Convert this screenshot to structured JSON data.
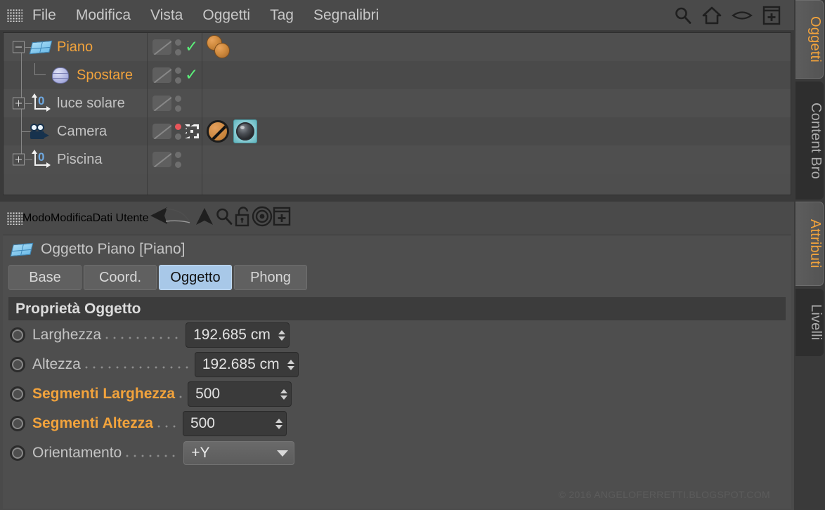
{
  "object_manager": {
    "menu": [
      "File",
      "Modifica",
      "Vista",
      "Oggetti",
      "Tag",
      "Segnalibri"
    ],
    "toolbar_icons": [
      "search-icon",
      "home-icon",
      "eye-icon",
      "add-box-icon"
    ],
    "tree": [
      {
        "name": "Piano",
        "selected": true,
        "icon": "plane-object-icon",
        "expander": "minus",
        "depth": 0,
        "visibility": "check",
        "tags": [
          "material-sphere",
          "material-sphere"
        ]
      },
      {
        "name": "Spostare",
        "selected": true,
        "icon": "deformer-object-icon",
        "expander": "none",
        "depth": 1,
        "visibility": "check",
        "tags": []
      },
      {
        "name": "luce solare",
        "selected": false,
        "icon": "null-axis-icon",
        "expander": "plus",
        "depth": 0,
        "visibility": "none",
        "tags": []
      },
      {
        "name": "Camera",
        "selected": false,
        "icon": "camera-object-icon",
        "expander": "none",
        "depth": 0,
        "visibility": "active-red",
        "tags": [
          "prohibit-icon",
          "camera-lens-tag-icon"
        ]
      },
      {
        "name": "Piscina",
        "selected": false,
        "icon": "null-axis-icon",
        "expander": "plus",
        "depth": 0,
        "visibility": "none",
        "tags": []
      }
    ]
  },
  "side_tabs_top": [
    {
      "label": "Oggetti",
      "active": true
    },
    {
      "label": "Content Bro",
      "active": false
    }
  ],
  "side_tabs_bottom": [
    {
      "label": "Attributi",
      "active": true
    },
    {
      "label": "Livelli",
      "active": false
    }
  ],
  "attributes_manager": {
    "menu": [
      "Modo",
      "Modifica",
      "Dati Utente"
    ],
    "toolbar_icons": [
      "back-arrow-icon",
      "up-arrow-icon",
      "search-icon",
      "unlock-icon",
      "target-icon",
      "add-box-icon"
    ],
    "object_title": "Oggetto Piano [Piano]",
    "object_icon": "plane-object-icon",
    "tabs": [
      {
        "label": "Base",
        "active": false
      },
      {
        "label": "Coord.",
        "active": false
      },
      {
        "label": "Oggetto",
        "active": true
      },
      {
        "label": "Phong",
        "active": false
      }
    ],
    "section_title": "Proprietà Oggetto",
    "properties": [
      {
        "label": "Larghezza",
        "value": "192.685 cm",
        "control": "number",
        "accent": false
      },
      {
        "label": "Altezza",
        "value": "192.685 cm",
        "control": "number",
        "accent": false
      },
      {
        "label": "Segmenti Larghezza",
        "value": "500",
        "control": "number",
        "accent": true
      },
      {
        "label": "Segmenti Altezza",
        "value": "500",
        "control": "number",
        "accent": true
      },
      {
        "label": "Orientamento",
        "value": "+Y",
        "control": "select",
        "accent": false
      }
    ]
  },
  "watermark": "© 2016 ANGELOFERRETTI.BLOGSPOT.COM",
  "colors": {
    "accent_orange": "#f2a33c",
    "active_tab_blue": "#a8c8e8",
    "check_green": "#5bf07a",
    "active_red": "#e8555a",
    "panel_bg": "#4a4a4a"
  }
}
